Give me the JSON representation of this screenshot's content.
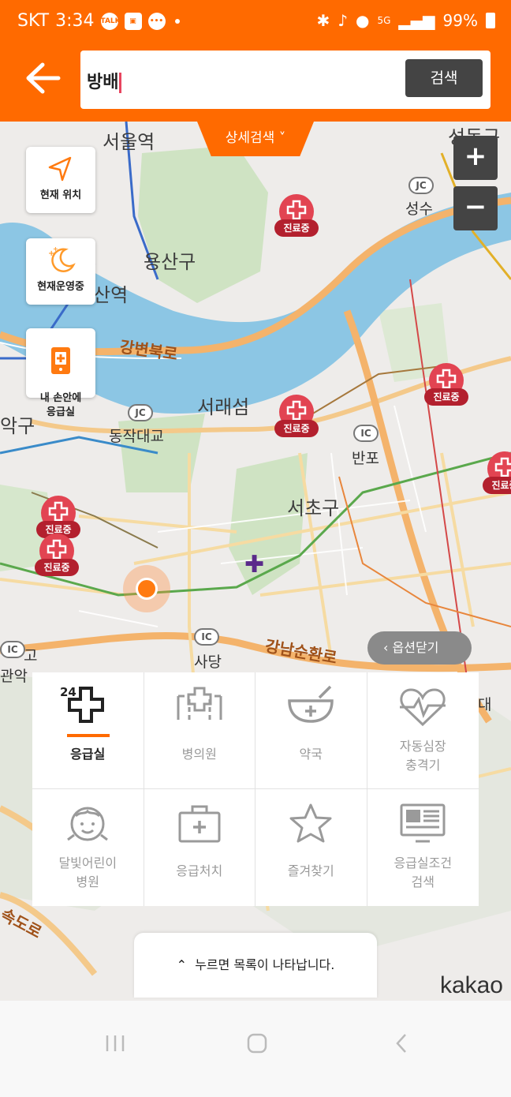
{
  "status_bar": {
    "carrier": "SKT",
    "time": "3:34",
    "notif_talk": "TALK",
    "network": "5G",
    "battery": "99%"
  },
  "search": {
    "query": "방배",
    "button_label": "검색"
  },
  "map": {
    "detail_search_label": "상세검색 ˅",
    "zoom_in_label": "+",
    "zoom_out_label": "−",
    "labels": {
      "seoul_station": "서울역",
      "seongdong": "성동구",
      "yongsan": "용산구",
      "yongsan_station": "산역",
      "seongsu": "성수",
      "gangbyeonbukro": "강변북로",
      "seoraeseom": "서래섬",
      "dongjak_bridge": "동작대교",
      "banpo": "반포",
      "seocho": "서초구",
      "sadang": "사당",
      "gangnam_sunhwan": "강남순환로",
      "gwanak": "관악",
      "gu_left": "악구",
      "go": "고",
      "sokdoro": "속도로",
      "dae": "대",
      "jc": "JC",
      "ic": "IC"
    },
    "marker_label": "진료중",
    "option_close_label": "옵션닫기"
  },
  "side_buttons": [
    {
      "label": "현재 위치",
      "icon": "navigation-arrow-icon"
    },
    {
      "label": "현재운영중",
      "icon": "moon-icon"
    },
    {
      "label": "내 손안에\n응급실",
      "icon": "phone-icon"
    }
  ],
  "categories": [
    {
      "label": "응급실",
      "icon": "emergency-24-icon",
      "active": true,
      "badge": "24"
    },
    {
      "label": "병의원",
      "icon": "hospital-icon",
      "active": false
    },
    {
      "label": "약국",
      "icon": "pharmacy-bowl-icon",
      "active": false
    },
    {
      "label": "자동심장\n충격기",
      "icon": "heart-pulse-icon",
      "active": false
    },
    {
      "label": "달빛어린이\n병원",
      "icon": "child-face-icon",
      "active": false
    },
    {
      "label": "응급처치",
      "icon": "first-aid-kit-icon",
      "active": false
    },
    {
      "label": "즐겨찾기",
      "icon": "star-icon",
      "active": false
    },
    {
      "label": "응급실조건\n검색",
      "icon": "monitor-icon",
      "active": false
    }
  ],
  "list_hint": "누르면 목록이 나타납니다.",
  "brand": "kakao",
  "colors": {
    "accent": "#ff6a00",
    "marker_red": "#e24452",
    "marker_tag": "#b3202e",
    "river": "#8cc6e4",
    "park": "#cfe3c3"
  }
}
